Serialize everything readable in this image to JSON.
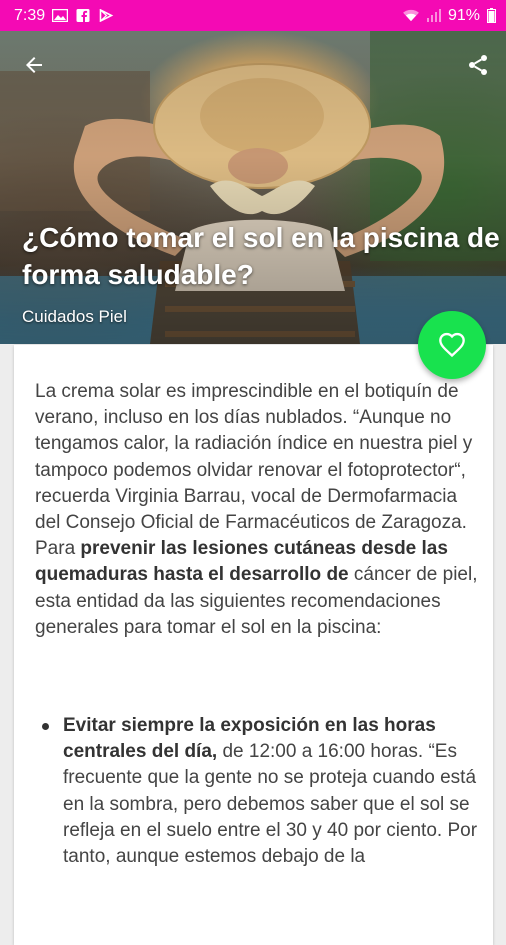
{
  "status_bar": {
    "time": "7:39",
    "battery": "91%",
    "left_icons": [
      "image-icon",
      "facebook-icon",
      "play-store-icon"
    ],
    "right_icons": [
      "wifi-icon",
      "signal-icon",
      "battery-icon"
    ],
    "background": "#f40ab4"
  },
  "header": {
    "back_icon": "arrow-left-icon",
    "share_icon": "share-icon",
    "title": "¿Cómo tomar el sol en la piscina de forma saludable?",
    "category": "Cuidados Piel"
  },
  "favorite": {
    "icon": "heart-outline-icon",
    "color": "#18e24e"
  },
  "article": {
    "p1_a": "La crema solar es imprescindible en el botiquín de verano, incluso en los días nublados. “Aunque no tengamos calor, la radiación índice en nuestra piel y tampoco podemos olvidar renovar el fotoprotector“, recuerda Virginia Barrau, vocal de Dermofarmacia del Consejo Oficial de Farmacéuticos de Zaragoza. Para ",
    "p1_bold": "prevenir las lesiones cutáneas desde las quemaduras hasta el desarrollo de",
    "p1_b": " cáncer de piel, esta entidad da las siguientes recomendaciones generales para tomar el sol en la piscina:",
    "bullets": [
      {
        "bold": "Evitar siempre la exposición en las horas centrales del día,",
        "text": " de 12:00 a 16:00 horas. “Es frecuente que la gente no se proteja cuando está en la sombra, pero debemos saber que el sol se refleja en el suelo entre el 30 y 40 por ciento. Por tanto, aunque estemos debajo de la"
      }
    ]
  }
}
